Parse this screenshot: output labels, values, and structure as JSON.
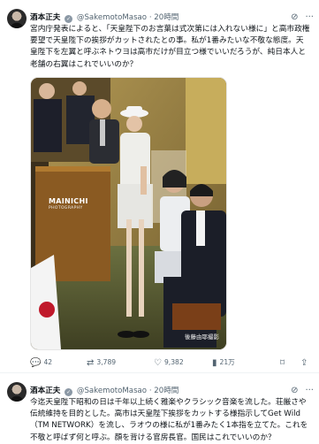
{
  "tweet1": {
    "display_name": "酒本正夫",
    "handle": "@SakemotoMasao",
    "separator": "·",
    "time": "20時間",
    "body": "宮内庁発表によると、「天皇陛下のお言葉は式次第には入れない様に」と高市政権要望で天皇陛下の挨拶がカットされたとの事。私が1番みたいな不敬な態度。天皇陛下を左翼と呼ぶネトウヨは高市だけが目立つ様でいいだろうが、純日本人と老舗の右翼はこれでいいのか？",
    "watermark_brand": "MAINICHI",
    "watermark_sub": "PHOTOGRAPHY",
    "photo_credit": "後藤由耶撮影",
    "actions": {
      "replies": "42",
      "retweets": "3,789",
      "likes": "9,382",
      "views": "21万"
    }
  },
  "tweet2": {
    "display_name": "酒本正夫",
    "handle": "@SakemotoMasao",
    "separator": "·",
    "time": "20時間",
    "body": "今迄天皇陛下昭和の日は千年以上続く雅楽やクラシック音楽を流した。荘厳さや伝統維持を目的とした。高市は天皇陛下挨拶をカットする様指示してGet Wild（TM NETWORK）を流し、ラオウの様に私が1番みたく1本指を立てた。これを不敬と呼ばず何と呼ぶ。顔を背ける官房長官。国民はこれでいいのか？"
  },
  "icons": {
    "verified": "verified-badge-icon",
    "grok": "grok-icon",
    "more": "more-icon",
    "reply": "reply-icon",
    "retweet": "retweet-icon",
    "like": "like-icon",
    "views": "views-icon",
    "bookmark": "bookmark-icon",
    "share": "share-icon"
  }
}
